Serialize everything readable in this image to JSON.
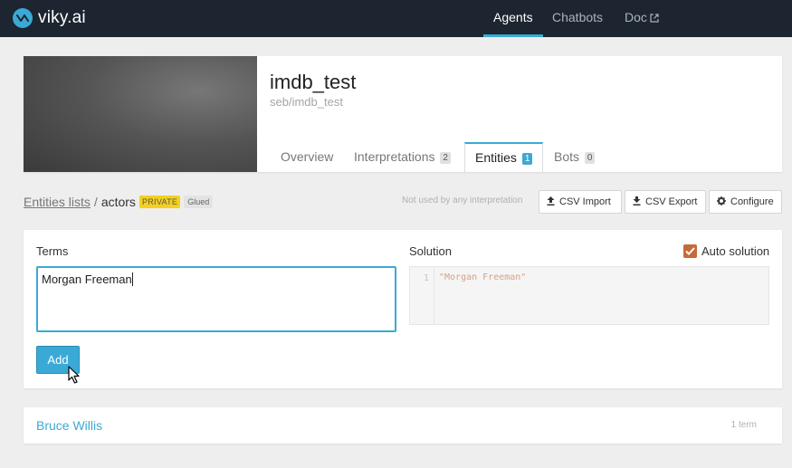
{
  "brand": {
    "name": "viky.ai",
    "accent": "#3aa9d6",
    "topbar_bg": "#1c2530"
  },
  "nav": {
    "items": [
      {
        "label": "Agents",
        "active": true
      },
      {
        "label": "Chatbots",
        "active": false
      },
      {
        "label": "Doc",
        "active": false,
        "icon": "external-link-icon"
      }
    ]
  },
  "agent": {
    "name": "imdb_test",
    "slug": "seb/imdb_test",
    "tabs": [
      {
        "label": "Overview",
        "count": null,
        "active": false
      },
      {
        "label": "Interpretations",
        "count": "2",
        "active": false
      },
      {
        "label": "Entities",
        "count": "1",
        "active": true
      },
      {
        "label": "Bots",
        "count": "0",
        "active": false
      }
    ]
  },
  "breadcrumb": {
    "parent": "Entities lists",
    "separator": "/",
    "current": "actors",
    "private_badge": "PRIVATE",
    "glued_badge": "Glued"
  },
  "toolbar": {
    "usage_note": "Not used by any interpretation",
    "csv_import": "CSV Import",
    "csv_export": "CSV Export",
    "configure": "Configure"
  },
  "form": {
    "terms_label": "Terms",
    "terms_value": "Morgan Freeman",
    "solution_label": "Solution",
    "auto_solution_label": "Auto solution",
    "auto_solution_checked": true,
    "solution_line_number": "1",
    "solution_code": "\"Morgan Freeman\"",
    "add_label": "Add"
  },
  "entities": [
    {
      "name": "Bruce Willis",
      "count": "1 term"
    }
  ]
}
